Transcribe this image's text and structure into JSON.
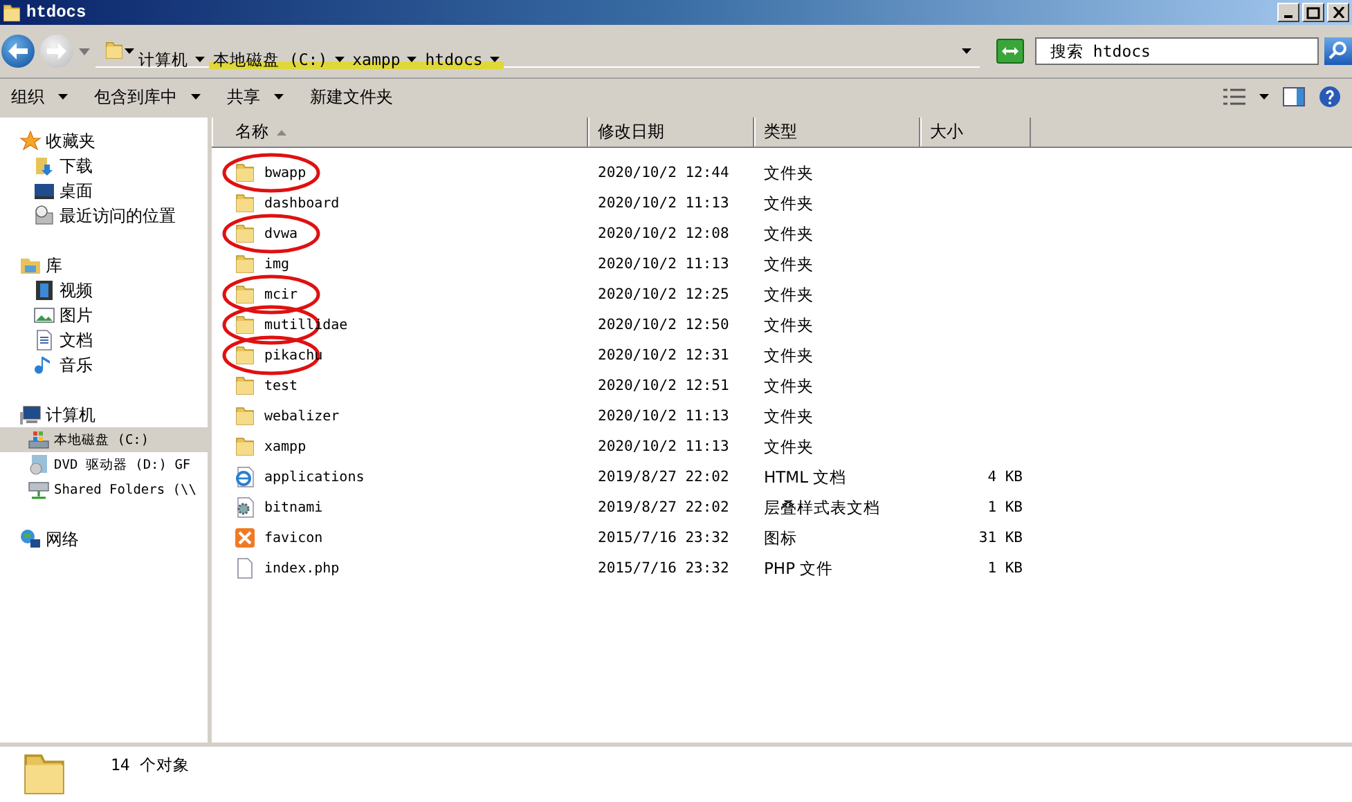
{
  "window": {
    "title": "htdocs"
  },
  "address": {
    "crumbs": [
      {
        "label": "计算机",
        "highlighted": false
      },
      {
        "label": "本地磁盘 (C:)",
        "highlighted": true
      },
      {
        "label": "xampp",
        "highlighted": true
      },
      {
        "label": "htdocs",
        "highlighted": true
      }
    ]
  },
  "search": {
    "placeholder": "搜索 htdocs"
  },
  "toolbar": {
    "buttons": [
      {
        "label": "组织",
        "dropdown": true
      },
      {
        "label": "包含到库中",
        "dropdown": true
      },
      {
        "label": "共享",
        "dropdown": true
      },
      {
        "label": "新建文件夹",
        "dropdown": false
      }
    ]
  },
  "sidebar": {
    "groups": [
      {
        "label": "收藏夹",
        "kind": "star",
        "children": [
          {
            "label": "下载",
            "kind": "download",
            "selected": false
          },
          {
            "label": "桌面",
            "kind": "desktop",
            "selected": false
          },
          {
            "label": "最近访问的位置",
            "kind": "recent",
            "selected": false
          }
        ]
      },
      {
        "label": "库",
        "kind": "library",
        "children": [
          {
            "label": "视频",
            "kind": "video",
            "selected": false
          },
          {
            "label": "图片",
            "kind": "picture",
            "selected": false
          },
          {
            "label": "文档",
            "kind": "doc",
            "selected": false
          },
          {
            "label": "音乐",
            "kind": "music",
            "selected": false
          }
        ]
      },
      {
        "label": "计算机",
        "kind": "computer",
        "children": [
          {
            "label": "本地磁盘 (C:)",
            "kind": "drive",
            "selected": true
          },
          {
            "label": "DVD 驱动器 (D:) GF",
            "kind": "dvd",
            "selected": false
          },
          {
            "label": "Shared Folders (\\\\",
            "kind": "share",
            "selected": false
          }
        ]
      },
      {
        "label": "网络",
        "kind": "network"
      }
    ]
  },
  "table": {
    "columns": [
      "名称",
      "修改日期",
      "类型",
      "大小"
    ],
    "rows": [
      {
        "name": "bwapp",
        "date": "2020/10/2 12:44",
        "type": "文件夹",
        "kind": "folder",
        "circled": true
      },
      {
        "name": "dashboard",
        "date": "2020/10/2 11:13",
        "type": "文件夹",
        "kind": "folder",
        "circled": false
      },
      {
        "name": "dvwa",
        "date": "2020/10/2 12:08",
        "type": "文件夹",
        "kind": "folder",
        "circled": true
      },
      {
        "name": "img",
        "date": "2020/10/2 11:13",
        "type": "文件夹",
        "kind": "folder",
        "circled": false
      },
      {
        "name": "mcir",
        "date": "2020/10/2 12:25",
        "type": "文件夹",
        "kind": "folder",
        "circled": true
      },
      {
        "name": "mutillidae",
        "date": "2020/10/2 12:50",
        "type": "文件夹",
        "kind": "folder",
        "circled": true
      },
      {
        "name": "pikachu",
        "date": "2020/10/2 12:31",
        "type": "文件夹",
        "kind": "folder",
        "circled": true
      },
      {
        "name": "test",
        "date": "2020/10/2 12:51",
        "type": "文件夹",
        "kind": "folder",
        "circled": false
      },
      {
        "name": "webalizer",
        "date": "2020/10/2 11:13",
        "type": "文件夹",
        "kind": "folder",
        "circled": false
      },
      {
        "name": "xampp",
        "date": "2020/10/2 11:13",
        "type": "文件夹",
        "kind": "folder",
        "circled": false
      },
      {
        "name": "applications",
        "date": "2019/8/27 22:02",
        "type": "HTML 文档",
        "size": "4 KB",
        "kind": "html",
        "circled": false
      },
      {
        "name": "bitnami",
        "date": "2019/8/27 22:02",
        "type": "层叠样式表文档",
        "size": "1 KB",
        "kind": "css",
        "circled": false
      },
      {
        "name": "favicon",
        "date": "2015/7/16 23:32",
        "type": "图标",
        "size": "31 KB",
        "kind": "ico",
        "circled": false
      },
      {
        "name": "index.php",
        "date": "2015/7/16 23:32",
        "type": "PHP 文件",
        "size": "1 KB",
        "kind": "file",
        "circled": false
      }
    ]
  },
  "status_bar": {
    "text": "14 个对象"
  }
}
